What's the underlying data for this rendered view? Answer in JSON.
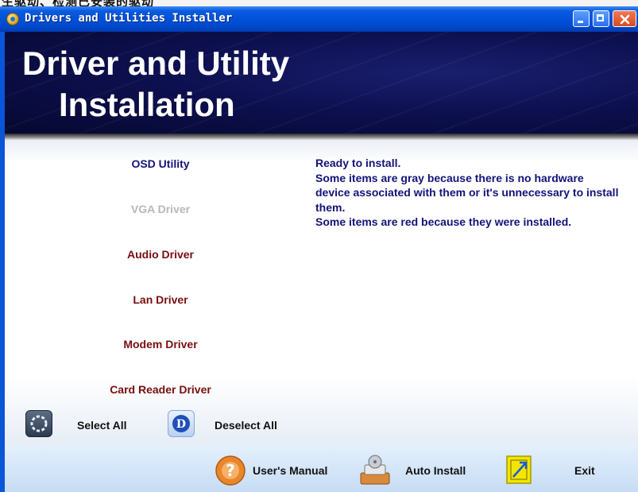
{
  "window": {
    "title": "Drivers and Utilities Installer",
    "background_text": "生驱动、检测已安装的驱动"
  },
  "banner": {
    "title_line1": "Driver and Utility",
    "title_line2": "Installation"
  },
  "items": [
    {
      "label": "OSD Utility",
      "state": "available",
      "color": "#13137a"
    },
    {
      "label": "VGA Driver",
      "state": "gray",
      "color": "#b8b8b8"
    },
    {
      "label": "Audio Driver",
      "state": "installed",
      "color": "#7a0e0e"
    },
    {
      "label": "Lan Driver",
      "state": "installed",
      "color": "#7a0e0e"
    },
    {
      "label": "Modem Driver",
      "state": "installed",
      "color": "#7a0e0e"
    },
    {
      "label": "Card Reader Driver",
      "state": "installed",
      "color": "#7a0e0e"
    }
  ],
  "status": {
    "line1": "Ready to install.",
    "line2": "Some items are gray because there is no hardware device associated with them or it's unnecessary to install them.",
    "line3": "Some items are red because they were installed."
  },
  "selection": {
    "select_all": "Select All",
    "deselect_all": "Deselect All",
    "deselect_icon_letter": "D"
  },
  "footer": {
    "users_manual": "User's Manual",
    "auto_install": "Auto Install",
    "exit": "Exit"
  },
  "colors": {
    "title_blue": "#0050d8",
    "banner_navy": "#0d1050",
    "text_blue": "#13137a",
    "installed_red": "#7a0e0e",
    "unavailable_gray": "#b8b8b8"
  }
}
